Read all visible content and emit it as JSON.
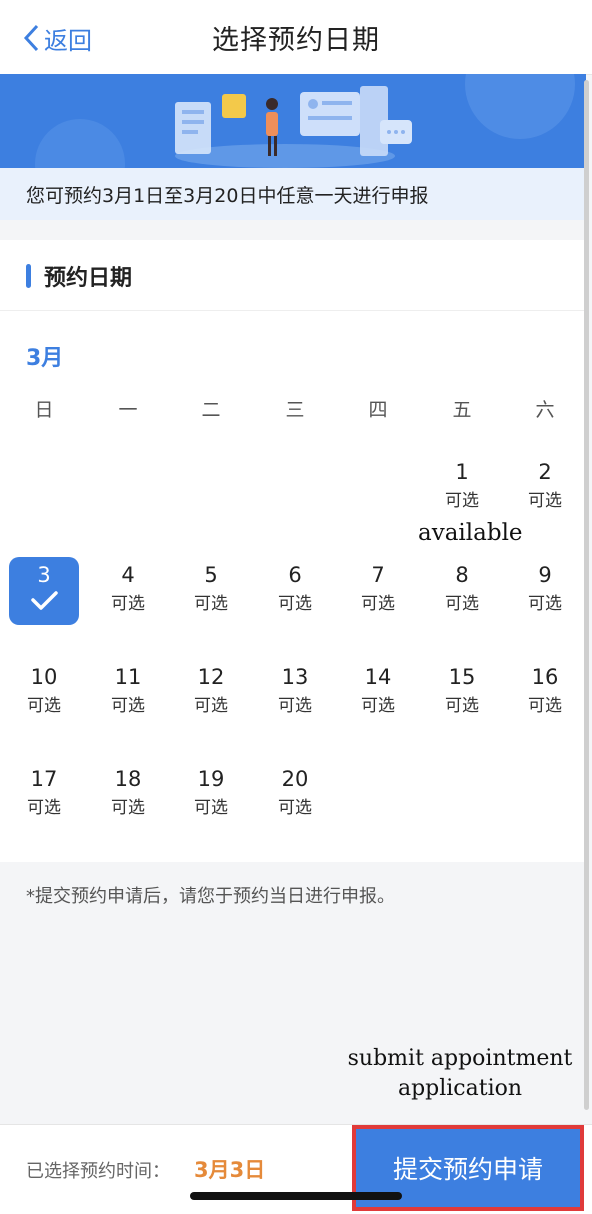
{
  "nav": {
    "back_label": "返回",
    "title": "选择预约日期"
  },
  "notice": "您可预约3月1日至3月20日中任意一天进行申报",
  "section": {
    "title": "预约日期"
  },
  "calendar": {
    "month": "3月",
    "weekdays": [
      "日",
      "一",
      "二",
      "三",
      "四",
      "五",
      "六"
    ],
    "available_label": "可选",
    "selected_day": "3",
    "days": [
      "1",
      "2",
      "3",
      "4",
      "5",
      "6",
      "7",
      "8",
      "9",
      "10",
      "11",
      "12",
      "13",
      "14",
      "15",
      "16",
      "17",
      "18",
      "19",
      "20"
    ]
  },
  "footnote": "*提交预约申请后，请您于预约当日进行申报。",
  "annotations": {
    "available": "available",
    "submit_line1": "submit appointment",
    "submit_line2": "application"
  },
  "bottom": {
    "selected_label": "已选择预约时间：",
    "selected_value": "3月3日",
    "submit_label": "提交预约申请"
  },
  "colors": {
    "accent": "#3d7fe0",
    "highlight_text": "#e58a3a",
    "annotation_box": "#e03a3a"
  }
}
